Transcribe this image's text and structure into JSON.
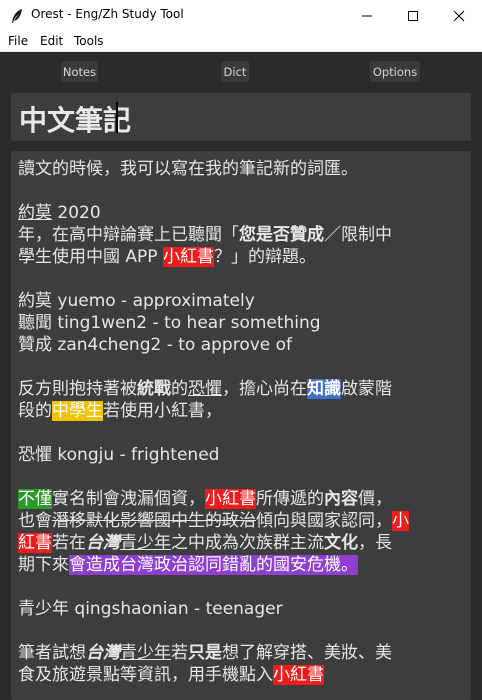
{
  "window": {
    "title": "Orest - Eng/Zh Study Tool",
    "icons": {
      "app": "feather-icon",
      "minimize": "minimize-icon",
      "maximize": "maximize-icon",
      "close": "close-icon"
    }
  },
  "menu": {
    "file": "File",
    "edit": "Edit",
    "tools": "Tools"
  },
  "toolbar": {
    "notes": "Notes",
    "dict": "Dict",
    "options": "Options"
  },
  "note": {
    "title": "中文筆記",
    "body": {
      "l1": "讀文的時候，我可以寫在我的筆記新的詞匯。",
      "l2a": "約莫",
      "l2b": " 2020",
      "l3a": "年，在高中辯論賽上已聽聞「",
      "l3b": "您是否贊成",
      "l3c": "／限制中",
      "l4a": "學生使用中國 APP ",
      "l4b": "小紅書",
      "l4c": "？」的辯題。",
      "l5": "約莫 yuemo - approximately",
      "l6": "聽聞 ting1wen2 - to hear something",
      "l7": "贊成 zan4cheng2 - to approve of",
      "l8a": "反方則抱持著被",
      "l8b": "統戰",
      "l8c": "的",
      "l8d": "恐懼",
      "l8e": "，擔心尚在",
      "l8f": "知識",
      "l8g": "啟蒙階",
      "l9a": "段的",
      "l9b": "中學生",
      "l9c": "若使用小紅書，",
      "l10": "恐懼 kongju - frightened",
      "l11a": "不僅",
      "l11b": "實名制會洩漏個資，",
      "l11c": "小紅書",
      "l11d": "所傳遞的",
      "l11e": "內容",
      "l11f": "價，",
      "l12a": "也會",
      "l12b": "潛移默化影響國中生的政治",
      "l12c": "傾向與國家認同，",
      "l12d": "小",
      "l13a": "紅書",
      "l13b": "若在",
      "l13c": "台灣",
      "l13d": "青少年",
      "l13e": "之中成為次族群主流",
      "l13f": "文化",
      "l13g": "，長",
      "l14a": "期下來",
      "l14b": "會造成台灣政治認同錯亂的國安危機。",
      "l15": "青少年 qingshaonian - teenager",
      "l16a": "筆者試想",
      "l16b": "台灣",
      "l16c": "青少年",
      "l16d": "若",
      "l16e": "只是",
      "l16f": "想了解穿搭、美妝、美",
      "l17a": "食及旅遊景點等資訊，用手機點入",
      "l17b": "小紅書"
    }
  },
  "colors": {
    "red": "#ee1c1c",
    "blue": "#3f6fc9",
    "yellow": "#f2c200",
    "green": "#2a9a2a",
    "purple": "#8e3fd0",
    "panel": "#3d3d3d",
    "background": "#2b2b2b"
  }
}
